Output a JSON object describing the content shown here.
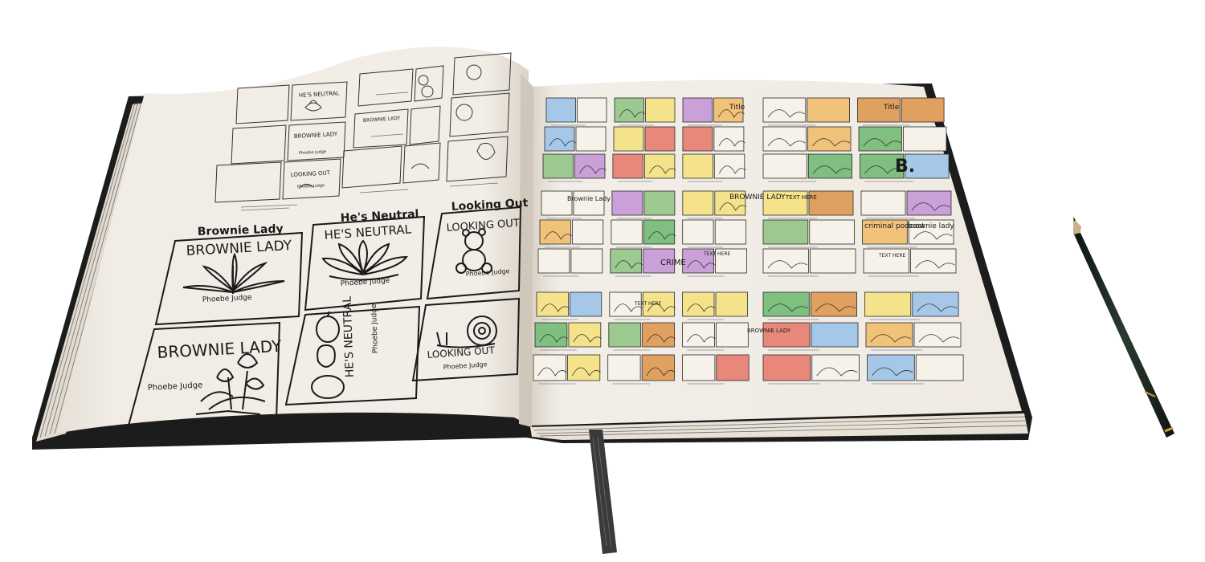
{
  "colors": {
    "background": "#ffffff",
    "paper": "#f1ede6",
    "paper_edge": "#e4ddd1",
    "cover": "#1c1c1c",
    "ink": "#1a1a1a",
    "ribbon": "#3a3a3a",
    "pencil_body": "#1e2a22",
    "pencil_gold": "#c9a23a"
  },
  "left_page": {
    "column_titles": [
      "Brownie Lady",
      "He's Neutral",
      "Looking Out"
    ],
    "thumbnails_top": [
      {
        "text": "HE'S NEUTRAL",
        "sub": ""
      },
      {
        "text": "BROWNIE LADY",
        "sub": "Phoebe Judge"
      },
      {
        "text": "LOOKING OUT",
        "sub": "Phoebe Judge"
      },
      {
        "text": "BROWNIE LADY",
        "sub": ""
      }
    ],
    "covers": [
      {
        "title": "BROWNIE LADY",
        "byline": "Phoebe Judge",
        "art": "leaf-icon"
      },
      {
        "title": "HE'S NEUTRAL",
        "byline": "Phoebe Judge",
        "art": "lotus-icon"
      },
      {
        "title": "LOOKING OUT",
        "byline": "Phoebe Judge",
        "art": "teddy-bear-icon"
      },
      {
        "title": "BROWNIE LADY",
        "byline": "Phoebe Judge",
        "art": "flowers-icon"
      },
      {
        "title": "HE'S NEUTRAL",
        "byline": "Phoebe Judge",
        "art": "pears-icon"
      },
      {
        "title": "LOOKING OUT",
        "byline": "Phoebe Judge",
        "art": "snail-icon"
      }
    ]
  },
  "right_page": {
    "storyboard_labels": [
      "Title",
      "Title",
      "Brownie Lady",
      "BROWNIE LADY",
      "TEXT HERE",
      "CRIME",
      "TEXT HERE",
      "TEXT HERE",
      "B.",
      "criminal podcast",
      "brownie lady",
      "BROWNIE LADY",
      "TEXT HERE"
    ]
  }
}
